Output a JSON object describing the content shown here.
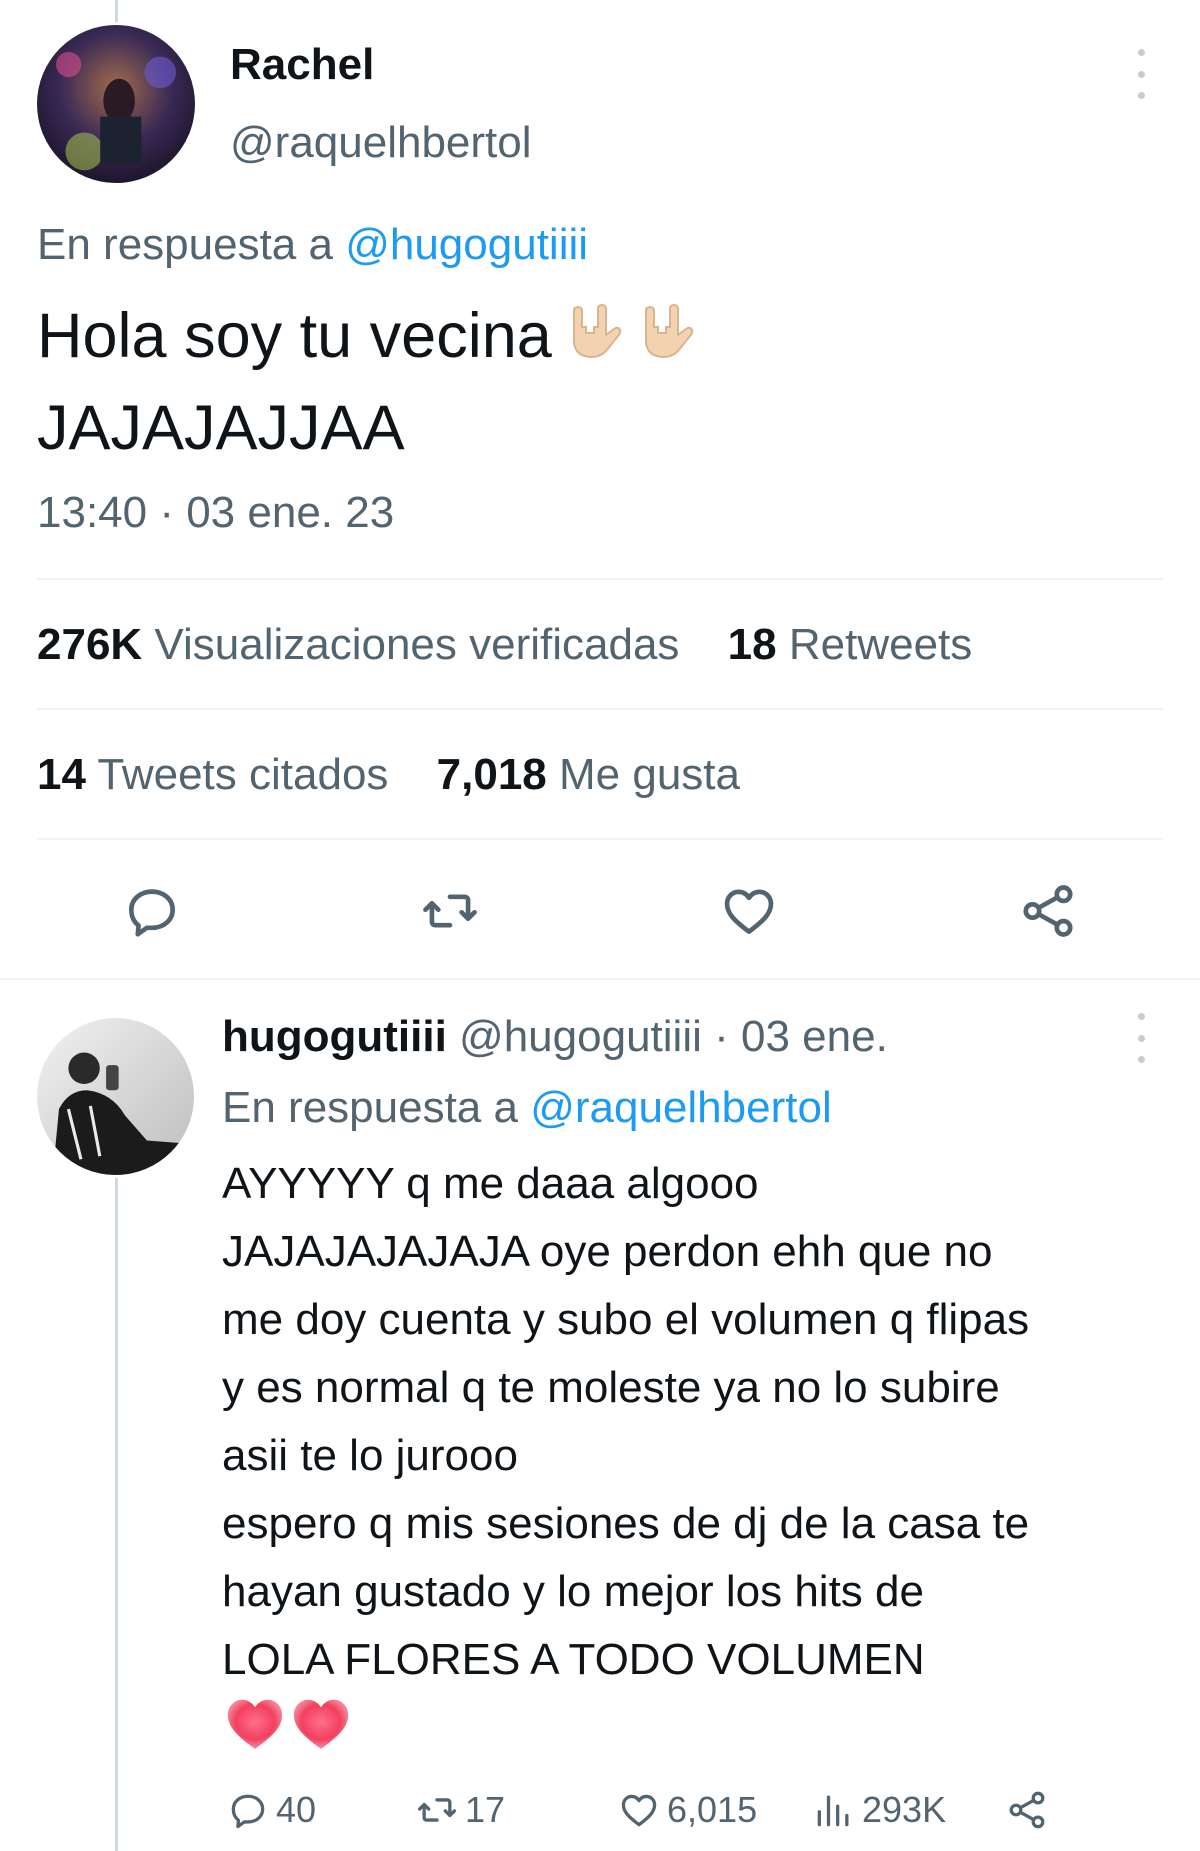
{
  "main_tweet": {
    "author": {
      "name": "Rachel",
      "handle": "@raquelhbertol"
    },
    "reply_context": {
      "prefix": "En respuesta a",
      "mention": "@hugogutiiii"
    },
    "text_line1": "Hola soy tu vecina",
    "text_line2": "JAJAJAJJAA",
    "emojis": [
      "love-you-gesture-icon",
      "love-you-gesture-icon"
    ],
    "timestamp": "13:40 · 03 ene. 23",
    "stats": {
      "views_value": "276K",
      "views_label": "Visualizaciones verificadas",
      "retweets_value": "18",
      "retweets_label": "Retweets",
      "quotes_value": "14",
      "quotes_label": "Tweets citados",
      "likes_value": "7,018",
      "likes_label": "Me gusta"
    },
    "actions": [
      "reply-icon",
      "retweet-icon",
      "like-icon",
      "share-icon"
    ]
  },
  "reply_tweet": {
    "author": {
      "name": "hugogutiiii",
      "handle": "@hugogutiiii",
      "date": "· 03 ene."
    },
    "reply_context": {
      "prefix": "En respuesta a",
      "mention": "@raquelhbertol"
    },
    "lines": [
      "AYYYYY q me daaa algooo",
      "JAJAJAJAJAJA oye perdon ehh que no",
      "me doy cuenta y subo el volumen q flipas",
      "y es normal q te moleste ya no lo subire",
      "asii te lo jurooo",
      "espero q mis sesiones de dj de la casa te",
      "hayan gustado y lo mejor los hits de",
      "LOLA FLORES A TODO VOLUMEN"
    ],
    "emojis": [
      "heart-icon",
      "heart-icon"
    ],
    "stats": {
      "replies": "40",
      "retweets": "17",
      "likes": "6,015",
      "views": "293K"
    }
  },
  "colors": {
    "text": "#0f1419",
    "secondary": "#536471",
    "link": "#1d9bf0",
    "divider": "#eff3f4"
  }
}
